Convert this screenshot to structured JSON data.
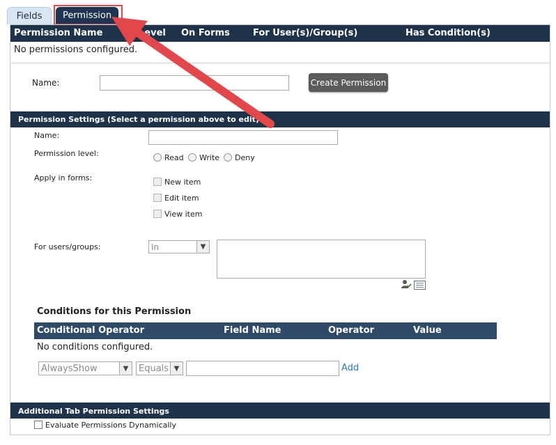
{
  "tabs": [
    {
      "label": "Fields"
    },
    {
      "label": "Permission"
    }
  ],
  "permissions_table": {
    "headers": [
      "Permission Name",
      "Level",
      "On Forms",
      "For User(s)/Group(s)",
      "Has Condition(s)"
    ],
    "empty_text": "No permissions configured."
  },
  "create": {
    "name_label": "Name:",
    "name_value": "",
    "button_label": "Create Permission"
  },
  "settings": {
    "title": "Permission Settings (Select a permission above to edit)",
    "name_label": "Name:",
    "name_value": "",
    "level_label": "Permission level:",
    "levels": [
      "Read",
      "Write",
      "Deny"
    ],
    "forms_label": "Apply in forms:",
    "forms": [
      "New item",
      "Edit item",
      "View item"
    ],
    "users_label": "For users/groups:",
    "users_mode": "In",
    "users_value": ""
  },
  "conditions": {
    "title": "Conditions for this Permission",
    "headers": [
      "Conditional Operator",
      "Field Name",
      "Operator",
      "Value"
    ],
    "empty_text": "No conditions configured.",
    "operator_select": "AlwaysShow",
    "comparison_select": "Equals",
    "value": "",
    "add_label": "Add"
  },
  "additional": {
    "title": "Additional Tab Permission Settings",
    "evaluate_label": "Evaluate Permissions Dynamically"
  },
  "colors": {
    "header_bar": "#1e3349",
    "active_tab": "#1d3550",
    "inactive_tab": "#d7e6f2",
    "highlight": "#e2474b",
    "button": "#5b5b5b",
    "link": "#2a7ab8"
  },
  "icons": [
    "address-book-icon",
    "browse-list-icon",
    "arrow-annotation"
  ]
}
